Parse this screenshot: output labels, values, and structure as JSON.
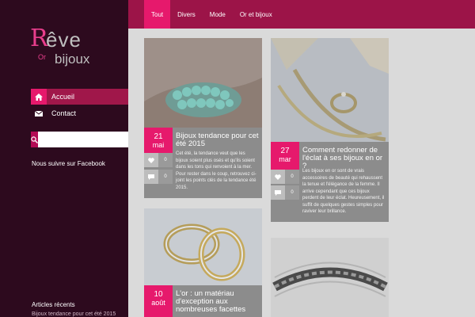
{
  "logo": {
    "r": "R",
    "eve": "êve",
    "or": "Or",
    "bijoux": "bijoux"
  },
  "nav": [
    {
      "label": "Accueil",
      "icon": "home-icon"
    },
    {
      "label": "Contact",
      "icon": "envelope-icon"
    }
  ],
  "search": {
    "placeholder": ""
  },
  "sidebar": {
    "facebook_heading": "Nous suivre sur Facebook",
    "recent_heading": "Articles récents",
    "recent_link": "Bijoux tendance pour cet été 2015"
  },
  "tabs": [
    "Tout",
    "Divers",
    "Mode",
    "Or et bijoux"
  ],
  "posts": [
    {
      "day": "21",
      "month": "mai",
      "title": "Bijoux tendance pour cet été 2015",
      "excerpt": "Cet été, la tendance veut que les bijoux soient plus osés et qu'ils soient dans les tons qui renvoient à la mer. Pour rester dans le coup, retrouvez ci-joint les points clés de la tendance été 2015.",
      "likes": "0",
      "comments": "0"
    },
    {
      "day": "27",
      "month": "mar",
      "title": "Comment redonner de l'éclat à ses bijoux en or ?",
      "excerpt": "Les bijoux en or sont de vrais accessoires de beauté qui rehaussent la tenue et l'élégance de la femme. Il arrive cependant que ces bijoux perdent de leur éclat. Heureusement, il suffit de quelques gestes simples pour raviver leur brillance.",
      "likes": "0",
      "comments": "0"
    },
    {
      "day": "10",
      "month": "août",
      "title": "L'or : un matériau d'exception aux nombreuses facettes"
    }
  ],
  "colors": {
    "accent": "#e6196c",
    "topbar": "#9c1448",
    "sidebar": "#2d0a1e"
  }
}
